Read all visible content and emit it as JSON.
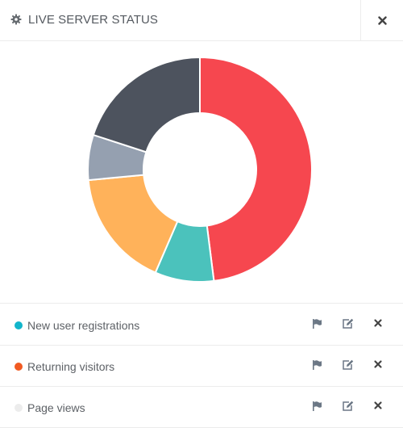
{
  "header": {
    "title": "LIVE SERVER STATUS",
    "icon": "gear-icon",
    "close_icon": "close-icon"
  },
  "chart_data": {
    "type": "pie",
    "donut": true,
    "values": [
      48,
      8.5,
      17,
      6.5,
      20
    ],
    "colors": [
      "#f6474f",
      "#4bc2bc",
      "#ffb25a",
      "#95a0b0",
      "#4d535e"
    ]
  },
  "legend": {
    "items": [
      {
        "label": "New user registrations",
        "color": "#12b5cb"
      },
      {
        "label": "Returning visitors",
        "color": "#f15a22"
      },
      {
        "label": "Page views",
        "color": "#ececec"
      }
    ],
    "actions": [
      "flag-icon",
      "edit-icon",
      "close-icon"
    ]
  }
}
